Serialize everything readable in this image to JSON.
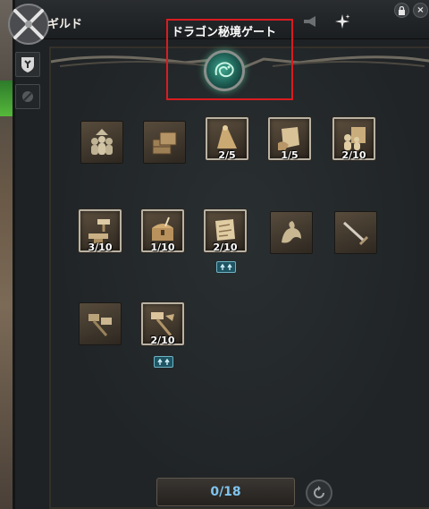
{
  "window": {
    "title": "ギルド"
  },
  "gate": {
    "label": "ドラゴン秘境ゲート"
  },
  "title_buttons": {
    "lock": "🔒",
    "close": "×"
  },
  "skills_row1": [
    {
      "icon": "followers-icon",
      "count": ""
    },
    {
      "icon": "crates-icon",
      "count": ""
    },
    {
      "icon": "horn-icon",
      "count": "2/5"
    },
    {
      "icon": "scroll-hand-icon",
      "count": "1/5"
    },
    {
      "icon": "troops-icon",
      "count": "2/10"
    }
  ],
  "skills_row2": [
    {
      "icon": "anvil-hammer-icon",
      "count": "3/10"
    },
    {
      "icon": "treasure-chest-icon",
      "count": "1/10"
    },
    {
      "icon": "map-scroll-icon",
      "count": "2/10"
    },
    {
      "icon": "dragon-icon",
      "count": ""
    },
    {
      "icon": "sword-icon",
      "count": ""
    }
  ],
  "skills_row3": [
    {
      "icon": "hammers-icon",
      "count": ""
    },
    {
      "icon": "forge-hammer-icon",
      "count": "2/10"
    }
  ],
  "bottom": {
    "points": "0/18"
  },
  "colors": {
    "highlight": "#d91c20",
    "points": "#7fc4ee",
    "badge": "#1f5563"
  }
}
